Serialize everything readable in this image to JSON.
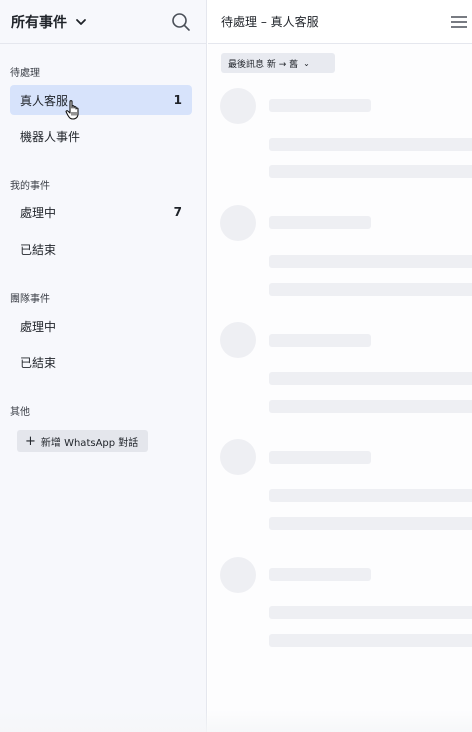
{
  "sidebar": {
    "title": "所有事件",
    "sections": [
      {
        "label": "待處理",
        "items": [
          {
            "label": "真人客服",
            "count": "1"
          },
          {
            "label": "機器人事件",
            "count": ""
          }
        ]
      },
      {
        "label": "我的事件",
        "items": [
          {
            "label": "處理中",
            "count": "7"
          },
          {
            "label": "已結束",
            "count": ""
          }
        ]
      },
      {
        "label": "團隊事件",
        "items": [
          {
            "label": "處理中",
            "count": ""
          },
          {
            "label": "已結束",
            "count": ""
          }
        ]
      },
      {
        "label": "其他"
      }
    ],
    "new_button": "新增 WhatsApp 對話",
    "active_color": "#d7e3fb"
  },
  "main": {
    "title": "待處理 – 真人客服",
    "sort_label": "最後訊息 新 → 舊"
  },
  "icons": [
    "chevron-down-icon",
    "search-icon",
    "hamburger-menu-icon",
    "plus-icon",
    "hand-cursor-icon"
  ]
}
